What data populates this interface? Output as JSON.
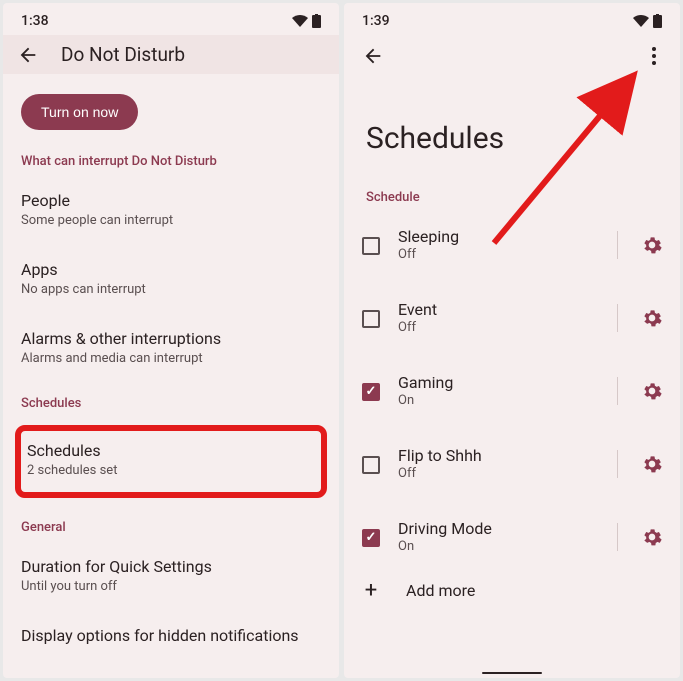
{
  "left": {
    "time": "1:38",
    "header_title": "Do Not Disturb",
    "turn_on_label": "Turn on now",
    "section_interrupt": "What can interrupt Do Not Disturb",
    "items": {
      "people": {
        "title": "People",
        "subtitle": "Some people can interrupt"
      },
      "apps": {
        "title": "Apps",
        "subtitle": "No apps can interrupt"
      },
      "alarms": {
        "title": "Alarms & other interruptions",
        "subtitle": "Alarms and media can interrupt"
      }
    },
    "section_schedules": "Schedules",
    "schedules_item": {
      "title": "Schedules",
      "subtitle": "2 schedules set"
    },
    "section_general": "General",
    "duration": {
      "title": "Duration for Quick Settings",
      "subtitle": "Until you turn off"
    },
    "display_options": {
      "title": "Display options for hidden notifications"
    }
  },
  "right": {
    "time": "1:39",
    "big_title": "Schedules",
    "section_label": "Schedule",
    "schedules": [
      {
        "name": "Sleeping",
        "status": "Off",
        "checked": false
      },
      {
        "name": "Event",
        "status": "Off",
        "checked": false
      },
      {
        "name": "Gaming",
        "status": "On",
        "checked": true
      },
      {
        "name": "Flip to Shhh",
        "status": "Off",
        "checked": false
      },
      {
        "name": "Driving Mode",
        "status": "On",
        "checked": true
      }
    ],
    "add_more_label": "Add more"
  }
}
